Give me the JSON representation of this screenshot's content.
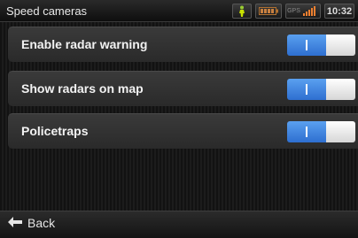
{
  "header": {
    "title": "Speed cameras",
    "status": {
      "gps_label": "GPS",
      "time": "10:32"
    }
  },
  "settings": [
    {
      "label": "Enable radar warning",
      "enabled": true
    },
    {
      "label": "Show radars on map",
      "enabled": true
    },
    {
      "label": "Policetraps",
      "enabled": true
    }
  ],
  "footer": {
    "back_label": "Back"
  },
  "colors": {
    "toggle_on": "#3a82e0",
    "background": "#151515",
    "row": "#333333",
    "text": "#f2f2f2"
  }
}
